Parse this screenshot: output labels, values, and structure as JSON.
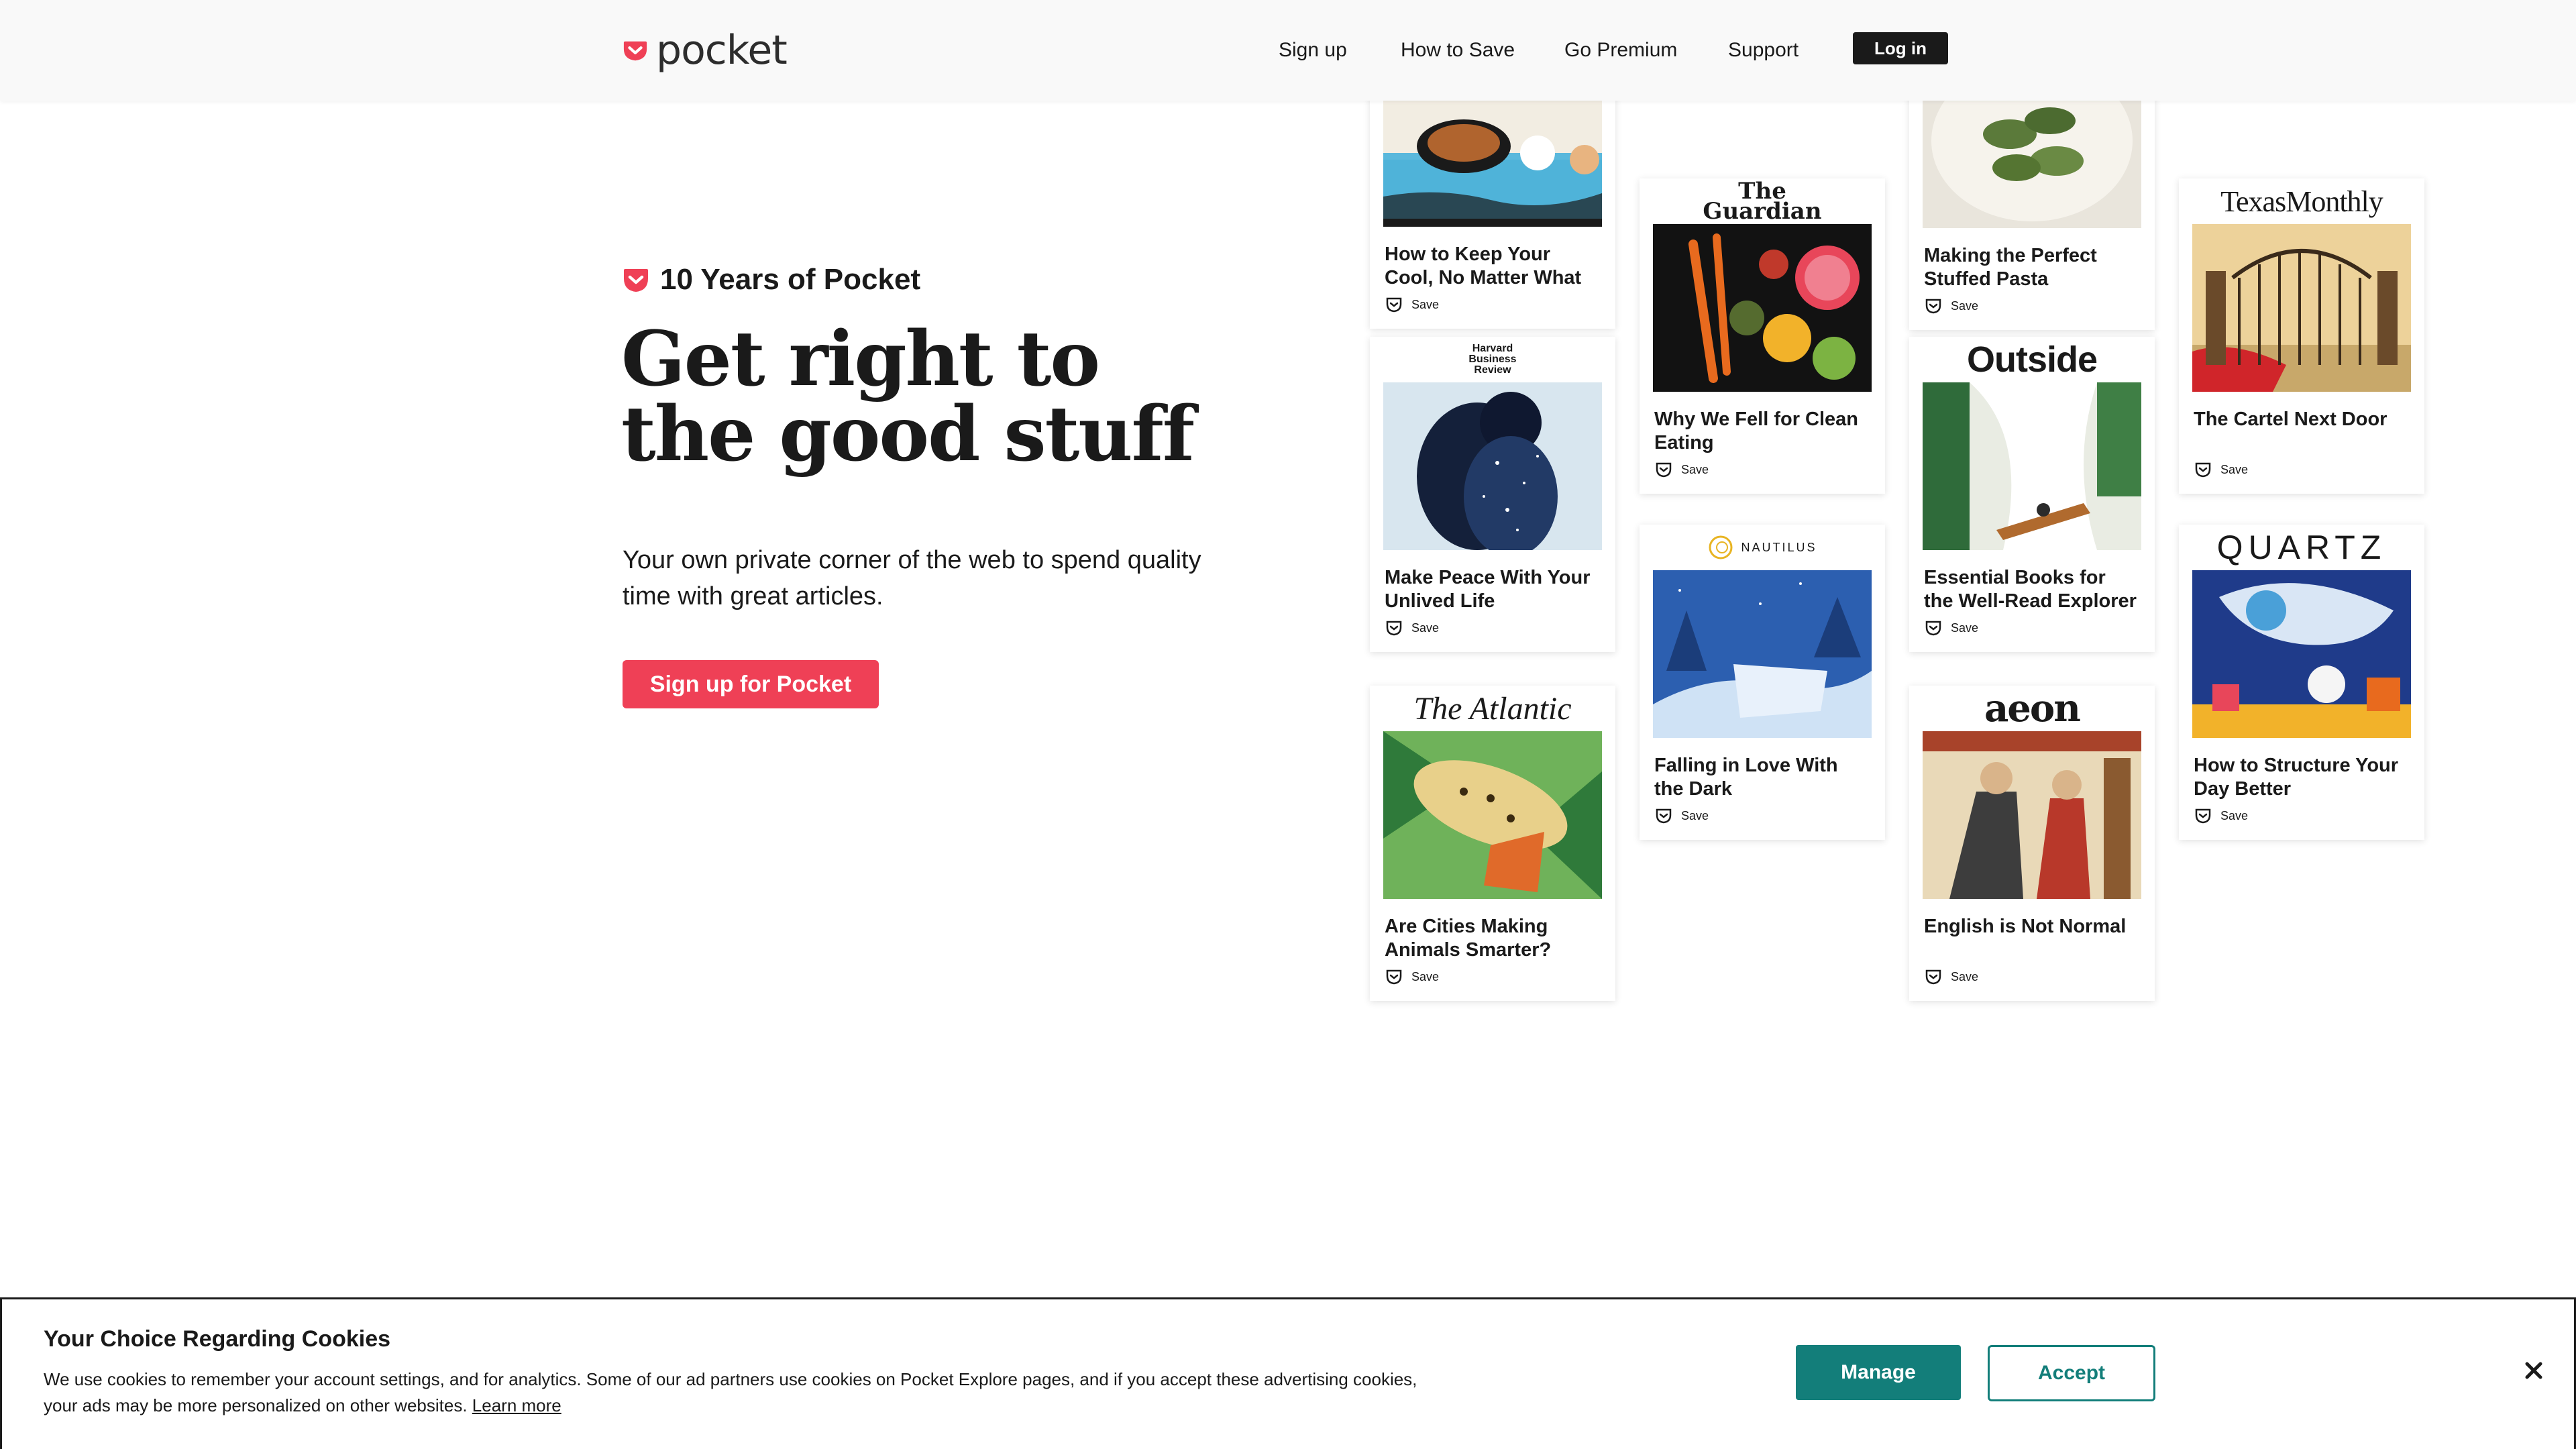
{
  "header": {
    "logo_text": "pocket",
    "nav": [
      {
        "label": "Sign up"
      },
      {
        "label": "How to Save"
      },
      {
        "label": "Go Premium"
      },
      {
        "label": "Support"
      }
    ],
    "login_label": "Log in"
  },
  "hero": {
    "eyebrow": "10 Years of Pocket",
    "headline_line1": "Get right to",
    "headline_line2": "the good stuff",
    "subhead": "Your own private corner of the web to spend quality time with great articles.",
    "cta_label": "Sign up for Pocket"
  },
  "cards": {
    "save_label": "Save",
    "items": [
      {
        "publisher": "",
        "title": "How to Keep Your Cool, No Matter What"
      },
      {
        "publisher": "Harvard Business Review",
        "title": "Make Peace With Your Unlived Life"
      },
      {
        "publisher": "The Atlantic",
        "title": "Are Cities Making Animals Smarter?"
      },
      {
        "publisher": "The Guardian",
        "title": "Why We Fell for Clean Eating"
      },
      {
        "publisher": "NAUTILUS",
        "title": "Falling in Love With the Dark"
      },
      {
        "publisher": "",
        "title": "Making the Perfect Stuffed Pasta"
      },
      {
        "publisher": "Outside",
        "title": "Essential Books for the Well-Read Explorer"
      },
      {
        "publisher": "aeon",
        "title": "English is Not Normal"
      },
      {
        "publisher": "TexasMonthly",
        "title": "The Cartel Next Door"
      },
      {
        "publisher": "QUARTZ",
        "title": "How to Structure Your Day Better"
      }
    ]
  },
  "cookie": {
    "title": "Your Choice Regarding Cookies",
    "text": "We use cookies to remember your account settings, and for analytics. Some of our ad partners use cookies on Pocket Explore pages, and if you accept these advertising cookies, your ads may be more personalized on other websites.",
    "learn_more": "Learn more",
    "manage_label": "Manage",
    "accept_label": "Accept"
  },
  "colors": {
    "brand_red": "#ef4056",
    "teal": "#137e7a",
    "text": "#1a1a1a",
    "header_bg": "#f9f9f9"
  }
}
